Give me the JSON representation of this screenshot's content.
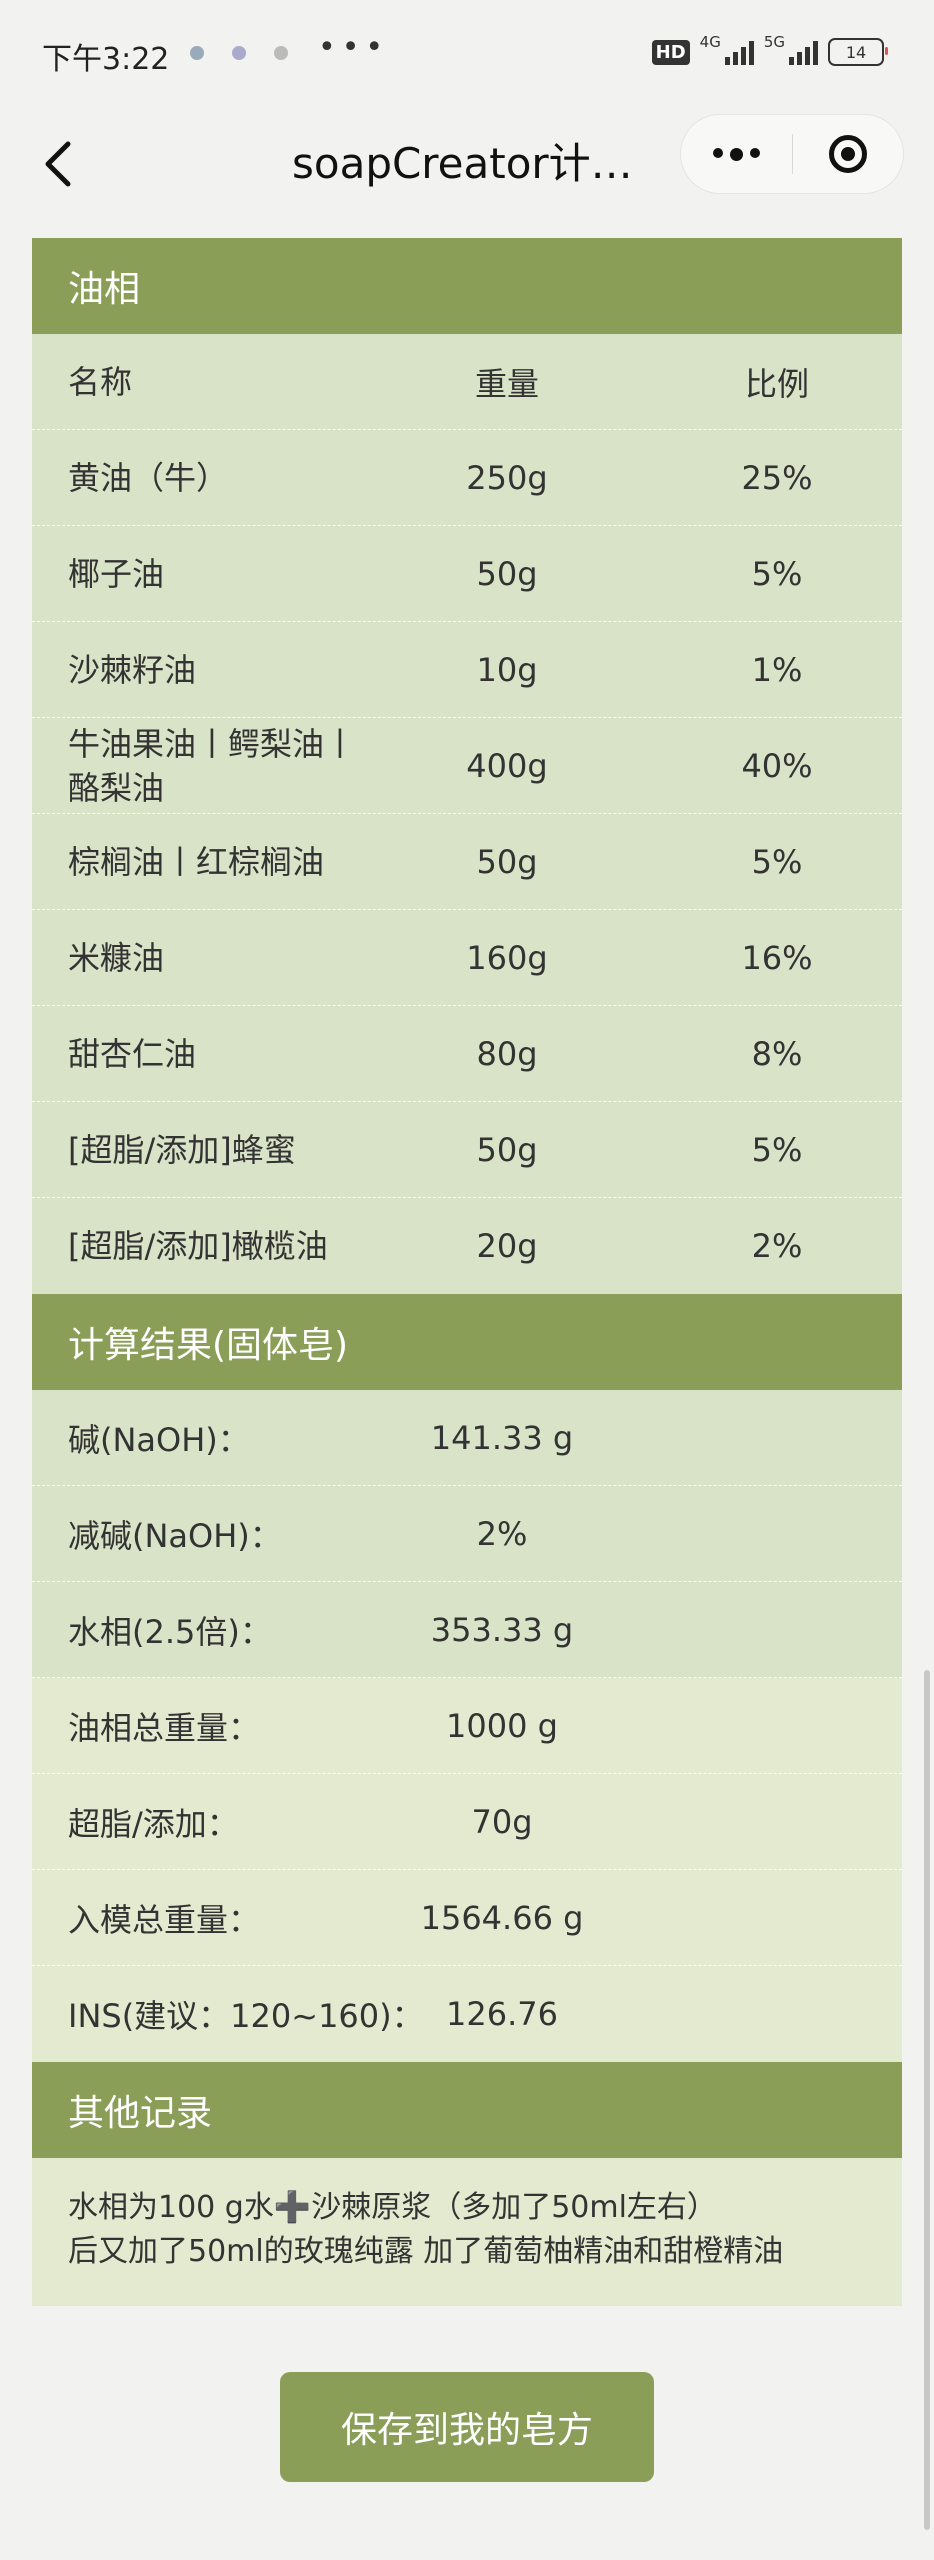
{
  "status": {
    "time": "下午3:22",
    "dots": "•••",
    "hd": "HD",
    "net1": "4G",
    "net2": "5G",
    "battery": "14"
  },
  "nav": {
    "title": "soapCreator计…"
  },
  "oil": {
    "header": "油相",
    "columns": [
      "名称",
      "重量",
      "比例"
    ],
    "rows": [
      {
        "name": "黄油（牛）",
        "weight": "250g",
        "ratio": "25%"
      },
      {
        "name": "椰子油",
        "weight": "50g",
        "ratio": "5%"
      },
      {
        "name": "沙棘籽油",
        "weight": "10g",
        "ratio": "1%"
      },
      {
        "name": "牛油果油丨鳄梨油丨酪梨油",
        "weight": "400g",
        "ratio": "40%"
      },
      {
        "name": "棕榈油丨红棕榈油",
        "weight": "50g",
        "ratio": "5%"
      },
      {
        "name": "米糠油",
        "weight": "160g",
        "ratio": "16%"
      },
      {
        "name": "甜杏仁油",
        "weight": "80g",
        "ratio": "8%"
      },
      {
        "name": "[超脂/添加]蜂蜜",
        "weight": "50g",
        "ratio": "5%"
      },
      {
        "name": "[超脂/添加]橄榄油",
        "weight": "20g",
        "ratio": "2%"
      }
    ]
  },
  "results": {
    "header": "计算结果(固体皂)",
    "rows": [
      {
        "label": "碱(NaOH)：",
        "value": "141.33 g"
      },
      {
        "label": "减碱(NaOH)：",
        "value": "2%"
      },
      {
        "label": "水相(2.5倍)：",
        "value": "353.33 g"
      },
      {
        "label": "油相总重量：",
        "value": "1000 g"
      },
      {
        "label": "超脂/添加：",
        "value": "70g"
      },
      {
        "label": "入模总重量：",
        "value": "1564.66 g"
      },
      {
        "label": "INS(建议：120~160)：",
        "value": "126.76"
      }
    ]
  },
  "notes": {
    "header": "其他记录",
    "lines": [
      "水相为100 g水➕沙棘原浆（多加了50ml左右）",
      "后又加了50ml的玫瑰纯露 加了葡萄柚精油和甜橙精油"
    ]
  },
  "save_button": "保存到我的皂方",
  "colors": {
    "accent": "#8a9e58",
    "row_bg": "#d9e3c7",
    "row_bg_light": "#e4eacf"
  }
}
